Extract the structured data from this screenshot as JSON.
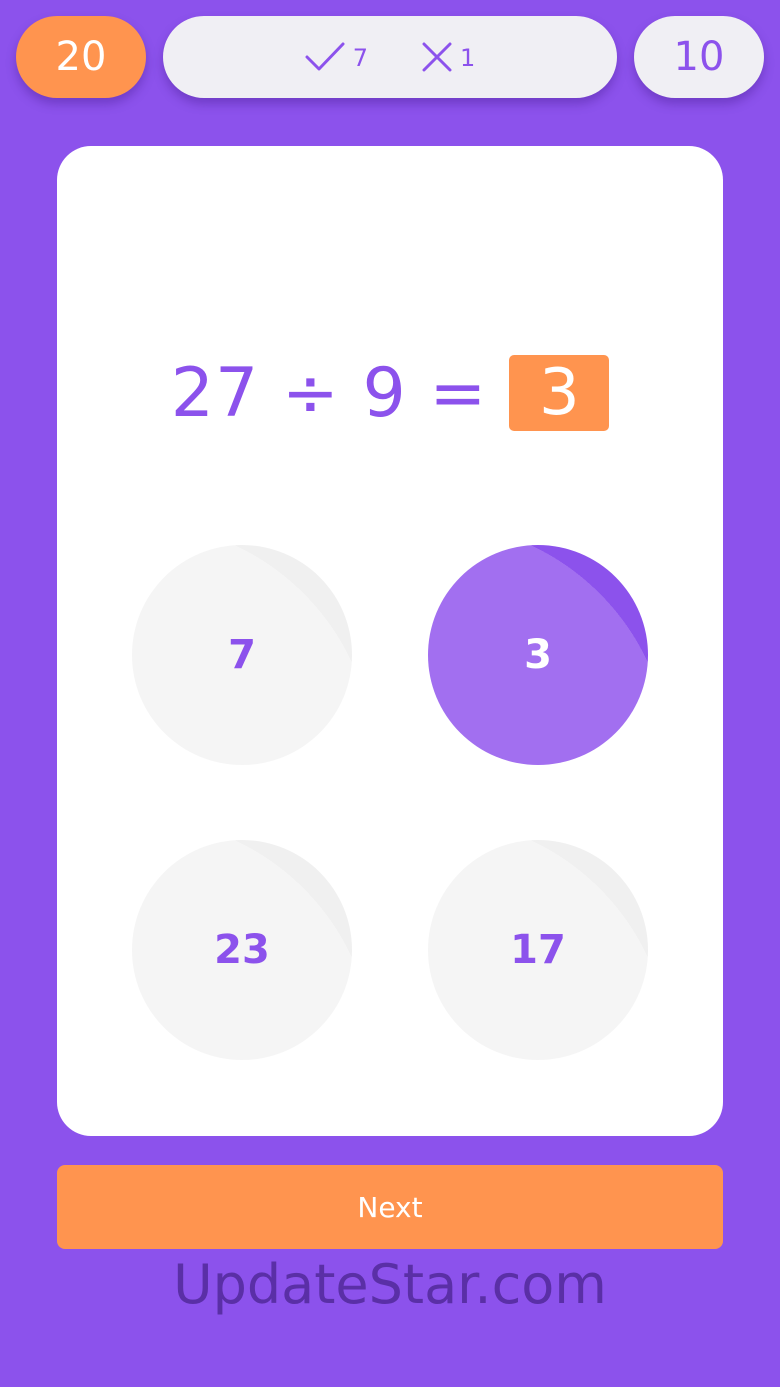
{
  "top_bar": {
    "timer": "20",
    "correct_count": "7",
    "wrong_count": "1",
    "question_count": "10"
  },
  "question": {
    "expression": "27 ÷ 9 =",
    "answer": "3"
  },
  "choices": [
    "7",
    "3",
    "23",
    "17"
  ],
  "selected_choice": "3",
  "next_label": "Next",
  "watermark": "UpdateStar.com",
  "colors": {
    "background": "#8c52ec",
    "accent": "#ff944f",
    "pill": "#f0eff4",
    "card": "#ffffff"
  },
  "icons": {
    "correct": "checkmark-icon",
    "wrong": "x-icon"
  }
}
